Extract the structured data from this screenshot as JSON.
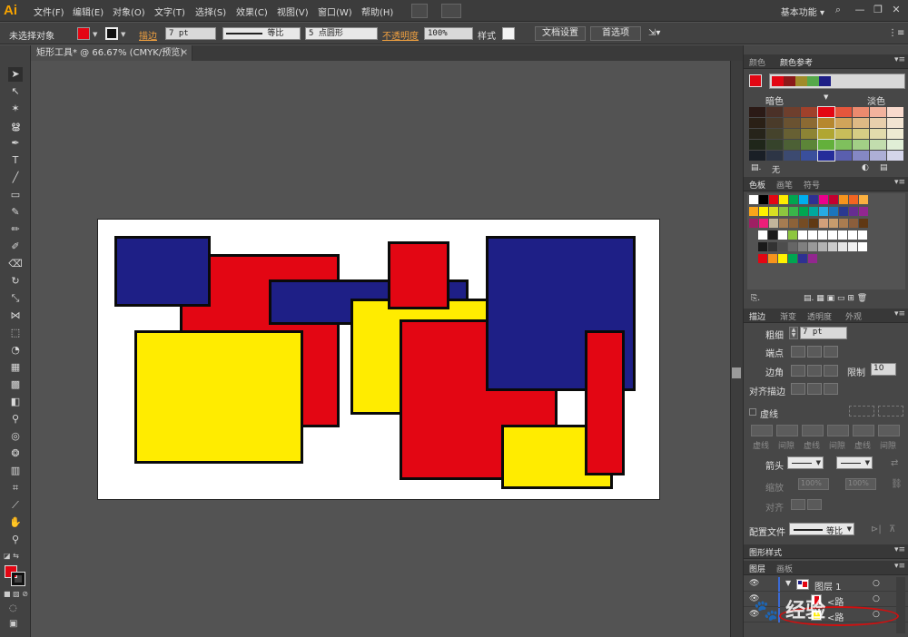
{
  "menubar": {
    "logo": "Ai",
    "items": [
      "文件(F)",
      "编辑(E)",
      "对象(O)",
      "文字(T)",
      "选择(S)",
      "效果(C)",
      "视图(V)",
      "窗口(W)",
      "帮助(H)"
    ],
    "workspace": "基本功能",
    "workspace_arrow": "▾",
    "search_icon": "⌕",
    "minimize": "—",
    "restore": "❐",
    "close": "✕"
  },
  "control": {
    "selection": "未选择对象",
    "stroke_label": "描边",
    "stroke_weight": "7 pt",
    "profile_label": "等比",
    "brush_label": "5 点圆形",
    "opacity_label": "不透明度",
    "opacity_value": "100%",
    "style_label": "样式",
    "doc_setup": "文档设置",
    "preferences": "首选项",
    "fill_color": "#e30613",
    "more_icon": "⋮≡"
  },
  "document_tab": {
    "title": "矩形工具* @ 66.67% (CMYK/预览)",
    "close": "✕"
  },
  "colors": {
    "blue": "#1e1f86",
    "red": "#e30613",
    "yellow": "#ffec00"
  },
  "color_guide": {
    "tabs": [
      "颜色",
      "颜色参考"
    ],
    "dark_label": "暗色",
    "light_label": "淡色",
    "none_label": "无",
    "harmony_colors": [
      "#e30613",
      "#8b1a1a",
      "#a08b2a",
      "#55a84a",
      "#1e1f86"
    ],
    "grid_columns": [
      [
        "#2b1a16",
        "#2a2016",
        "#26241a",
        "#1f261a",
        "#1a1f26"
      ],
      [
        "#4b3128",
        "#4a3b2a",
        "#45432c",
        "#36432b",
        "#2d3545"
      ],
      [
        "#6e3f2d",
        "#6a5231",
        "#676033",
        "#4c6035",
        "#3c4a70"
      ],
      [
        "#a0412b",
        "#8c6a33",
        "#8d8435",
        "#5c8538",
        "#3a4f9c"
      ],
      [
        "#e30613",
        "#b6872e",
        "#b0a632",
        "#63b03b",
        "#252d9a"
      ],
      [
        "#e5563c",
        "#d0a45a",
        "#c8bd5a",
        "#7fc05d",
        "#5a5fae"
      ],
      [
        "#ec8a6e",
        "#deb985",
        "#d6cd85",
        "#a2cf86",
        "#8588c4"
      ],
      [
        "#f2b29d",
        "#e8cfac",
        "#e2dbac",
        "#c2ddae",
        "#adafd6"
      ],
      [
        "#f8dacd",
        "#f2e4d2",
        "#eeead2",
        "#e0eed6",
        "#d4d5ea"
      ]
    ]
  },
  "swatches": {
    "tabs": [
      "色板",
      "画笔",
      "符号"
    ]
  },
  "stroke_panel": {
    "tabs": [
      "描边",
      "渐变",
      "透明度",
      "外观"
    ],
    "weight_label": "粗细",
    "weight_value": "7 pt",
    "cap_label": "端点",
    "corner_label": "边角",
    "limit_label": "限制",
    "limit_value": "10",
    "align_label": "对齐描边",
    "dashed_label": "虚线",
    "dash_labels": [
      "虚线",
      "间隙",
      "虚线",
      "间隙",
      "虚线",
      "间隙"
    ],
    "arrow_label": "箭头",
    "scale_label": "缩放",
    "scale1": "100%",
    "scale2": "100%",
    "align2_label": "对齐",
    "profile_label": "配置文件",
    "profile_value": "等比"
  },
  "graphic_styles": {
    "tab": "图形样式"
  },
  "layers_panel": {
    "tabs": [
      "图层",
      "画板"
    ],
    "layer_name": "图层 1",
    "item1": "<路",
    "item2": "<路"
  },
  "watermark": "经验"
}
